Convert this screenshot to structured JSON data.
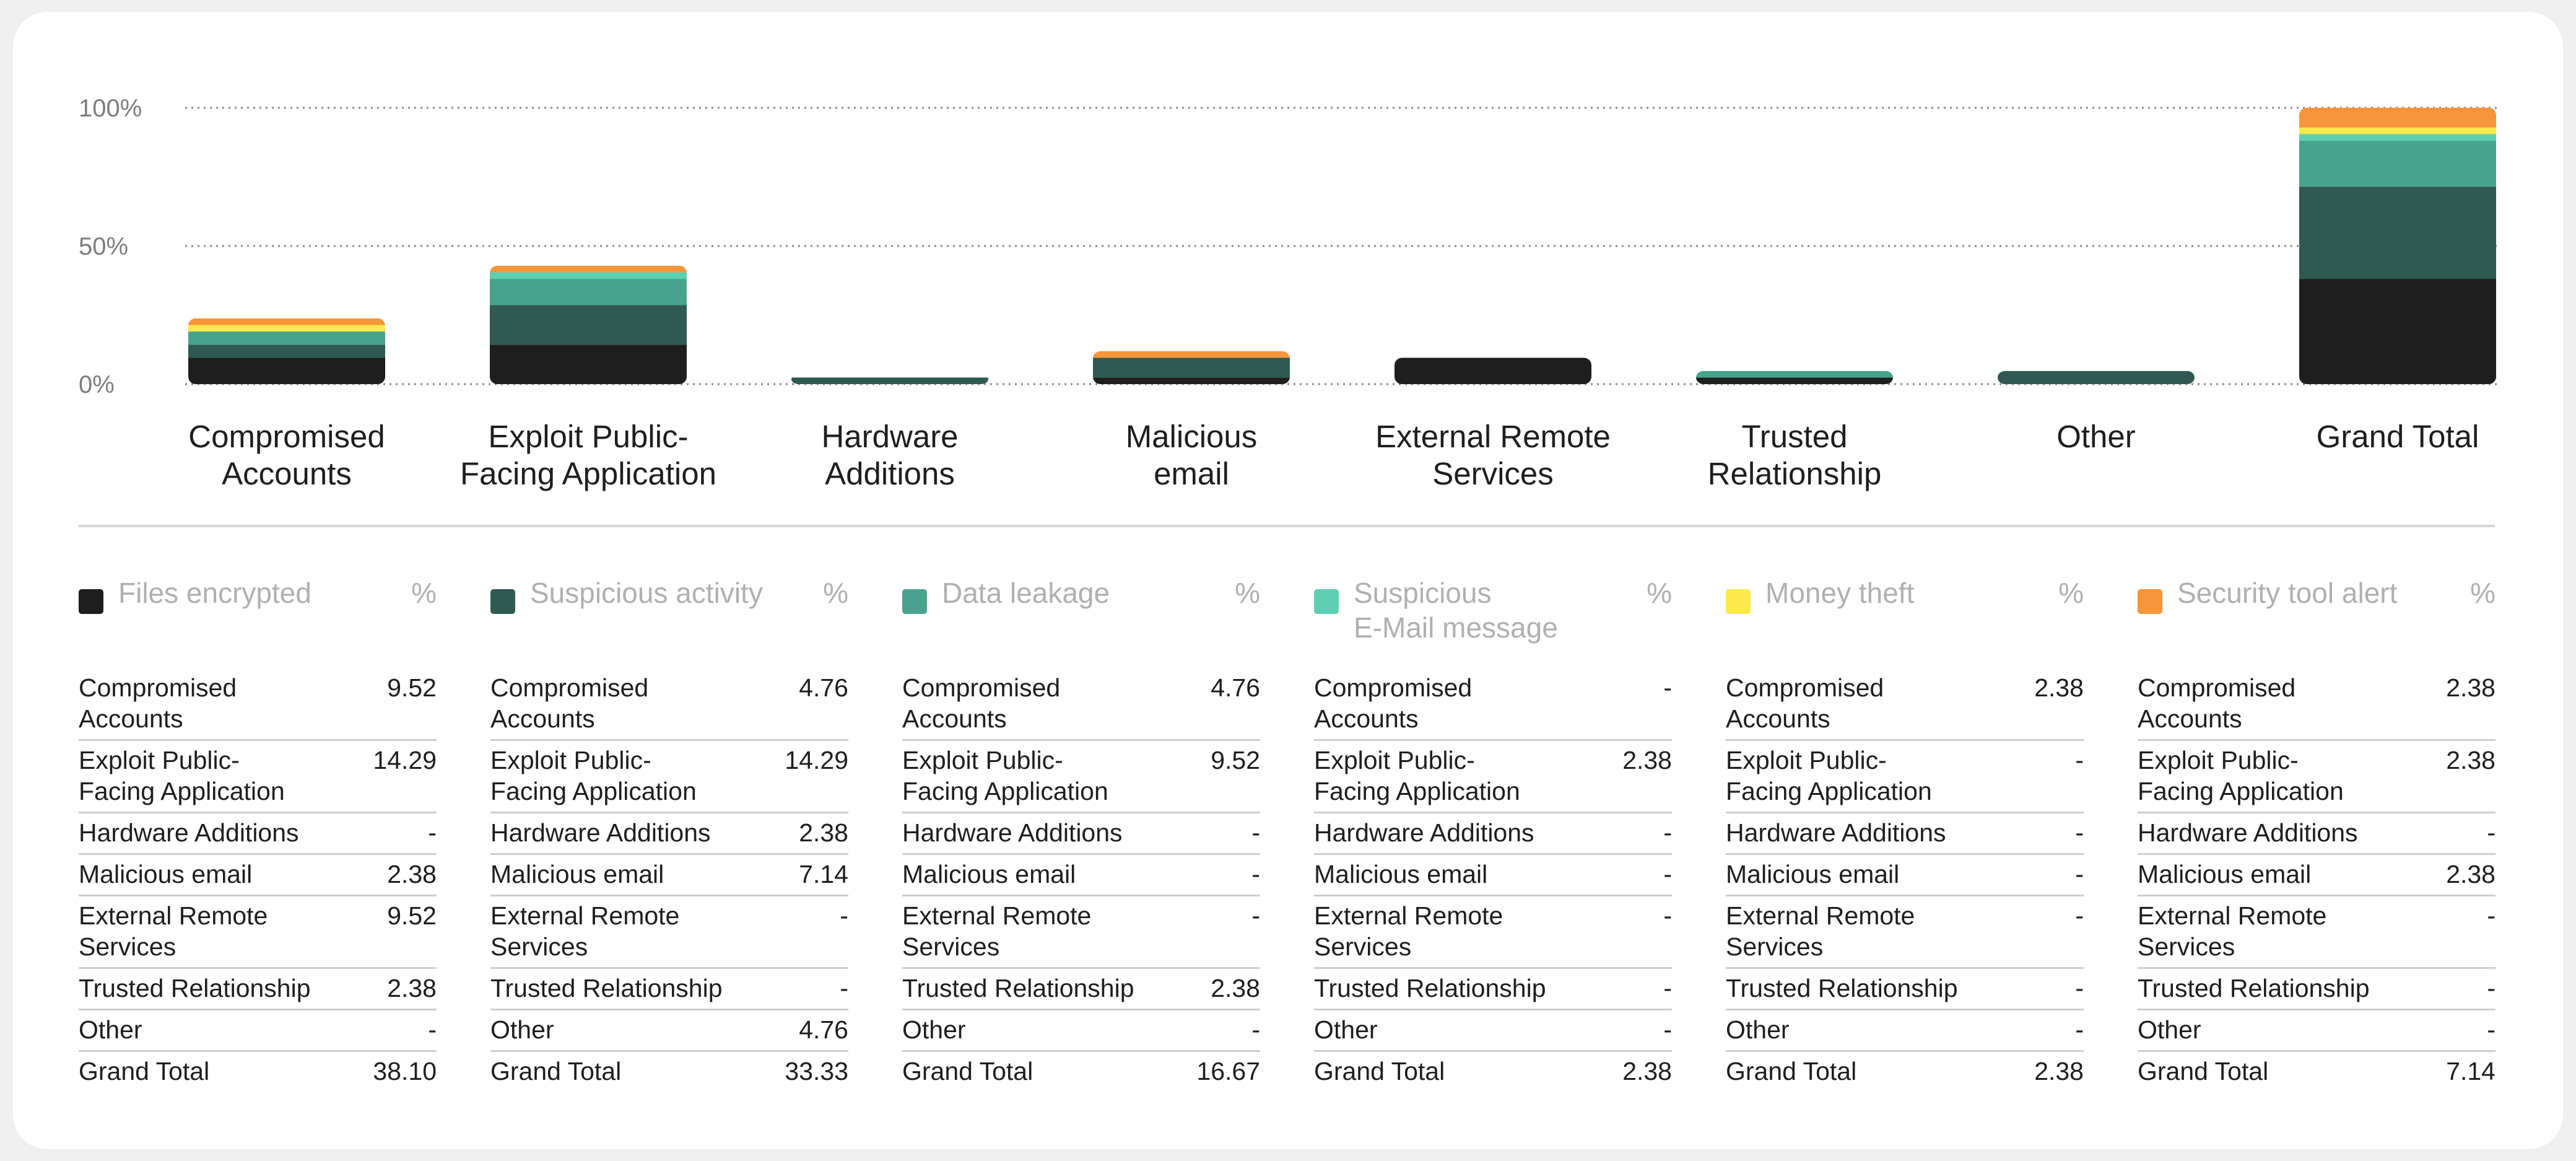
{
  "chart_data": {
    "type": "bar",
    "stacked": true,
    "categories": [
      "Compromised\nAccounts",
      "Exploit Public-\nFacing Application",
      "Hardware\nAdditions",
      "Malicious\nemail",
      "External Remote\nServices",
      "Trusted\nRelationship",
      "Other",
      "Grand Total"
    ],
    "y_ticks": [
      "0%",
      "50%",
      "100%"
    ],
    "ylim": [
      0,
      100
    ],
    "grid": true,
    "series": [
      {
        "name": "Files encrypted",
        "color": "#1e1e1e",
        "values": [
          9.52,
          14.29,
          0,
          2.38,
          9.52,
          2.38,
          0,
          38.1
        ]
      },
      {
        "name": "Suspicious activity",
        "color": "#2f5951",
        "values": [
          4.76,
          14.29,
          2.38,
          7.14,
          0,
          0,
          4.76,
          33.33
        ]
      },
      {
        "name": "Data leakage",
        "color": "#47a38d",
        "values": [
          4.76,
          9.52,
          0,
          0,
          0,
          2.38,
          0,
          16.67
        ]
      },
      {
        "name": "Suspicious\nE-Mail message",
        "color": "#5ed0b2",
        "values": [
          0,
          2.38,
          0,
          0,
          0,
          0,
          0,
          2.38
        ]
      },
      {
        "name": "Money theft",
        "color": "#fcea4b",
        "values": [
          2.38,
          0,
          0,
          0,
          0,
          0,
          0,
          2.38
        ]
      },
      {
        "name": "Security tool alert",
        "color": "#f6953a",
        "values": [
          2.38,
          2.38,
          0,
          2.38,
          0,
          0,
          0,
          7.14
        ]
      }
    ]
  },
  "table": {
    "pct_header": "%",
    "columns": [
      {
        "rows": [
          [
            "Compromised\nAccounts",
            "9.52"
          ],
          [
            "Exploit Public-\nFacing Application",
            "14.29"
          ],
          [
            "Hardware Additions",
            "-"
          ],
          [
            "Malicious email",
            "2.38"
          ],
          [
            "External Remote\nServices",
            "9.52"
          ],
          [
            "Trusted Relationship",
            "2.38"
          ],
          [
            "Other",
            "-"
          ],
          [
            "Grand Total",
            "38.10"
          ]
        ]
      },
      {
        "rows": [
          [
            "Compromised\nAccounts",
            "4.76"
          ],
          [
            "Exploit Public-\nFacing Application",
            "14.29"
          ],
          [
            "Hardware Additions",
            "2.38"
          ],
          [
            "Malicious email",
            "7.14"
          ],
          [
            "External Remote\nServices",
            "-"
          ],
          [
            "Trusted Relationship",
            "-"
          ],
          [
            "Other",
            "4.76"
          ],
          [
            "Grand Total",
            "33.33"
          ]
        ]
      },
      {
        "rows": [
          [
            "Compromised\nAccounts",
            "4.76"
          ],
          [
            "Exploit Public-\nFacing Application",
            "9.52"
          ],
          [
            "Hardware Additions",
            "-"
          ],
          [
            "Malicious email",
            "-"
          ],
          [
            "External Remote\nServices",
            "-"
          ],
          [
            "Trusted Relationship",
            "2.38"
          ],
          [
            "Other",
            "-"
          ],
          [
            "Grand Total",
            "16.67"
          ]
        ]
      },
      {
        "rows": [
          [
            "Compromised\nAccounts",
            "-"
          ],
          [
            "Exploit Public-\nFacing Application",
            "2.38"
          ],
          [
            "Hardware Additions",
            "-"
          ],
          [
            "Malicious email",
            "-"
          ],
          [
            "External Remote\nServices",
            "-"
          ],
          [
            "Trusted Relationship",
            "-"
          ],
          [
            "Other",
            "-"
          ],
          [
            "Grand Total",
            "2.38"
          ]
        ]
      },
      {
        "rows": [
          [
            "Compromised\nAccounts",
            "2.38"
          ],
          [
            "Exploit Public-\nFacing Application",
            "-"
          ],
          [
            "Hardware Additions",
            "-"
          ],
          [
            "Malicious email",
            "-"
          ],
          [
            "External Remote\nServices",
            "-"
          ],
          [
            "Trusted Relationship",
            "-"
          ],
          [
            "Other",
            "-"
          ],
          [
            "Grand Total",
            "2.38"
          ]
        ]
      },
      {
        "rows": [
          [
            "Compromised\nAccounts",
            "2.38"
          ],
          [
            "Exploit Public-\nFacing Application",
            "2.38"
          ],
          [
            "Hardware Additions",
            "-"
          ],
          [
            "Malicious email",
            "2.38"
          ],
          [
            "External Remote\nServices",
            "-"
          ],
          [
            "Trusted Relationship",
            "-"
          ],
          [
            "Other",
            "-"
          ],
          [
            "Grand Total",
            "7.14"
          ]
        ]
      }
    ]
  }
}
